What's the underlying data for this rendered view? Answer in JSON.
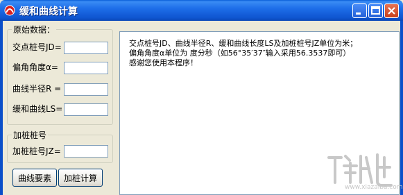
{
  "window": {
    "title": "缓和曲线计算",
    "icon": "red-curve-app-icon",
    "controls": [
      "minimize-icon",
      "maximize-icon",
      "close-icon"
    ]
  },
  "input_group": {
    "title": "原始数据：",
    "fields": [
      {
        "label": "交点桩号JD=",
        "value": ""
      },
      {
        "label": "偏角角度α=",
        "value": ""
      },
      {
        "label": "曲线半径R =",
        "value": ""
      },
      {
        "label": "缓和曲线LS=",
        "value": ""
      }
    ]
  },
  "station_group": {
    "title": "加桩桩号",
    "fields": [
      {
        "label": "加桩桩号JZ=",
        "value": ""
      }
    ]
  },
  "buttons": {
    "curve_elements": "曲线要素",
    "station_calc": "加桩计算"
  },
  "output": {
    "lines": [
      "交点桩号JD、曲线半径R、缓和曲线长度LS及加桩桩号JZ单位为米；",
      "偏角角度α单位为 度分秒（如56°35′37″输入采用56.3537即可）",
      "感谢您使用本程序！"
    ]
  },
  "watermark": {
    "caption": "www.xiazaiba.com"
  },
  "colors": {
    "titlebar": "#0f55d0",
    "window_bg": "#ece9d8",
    "input_border": "#7f9db9"
  }
}
